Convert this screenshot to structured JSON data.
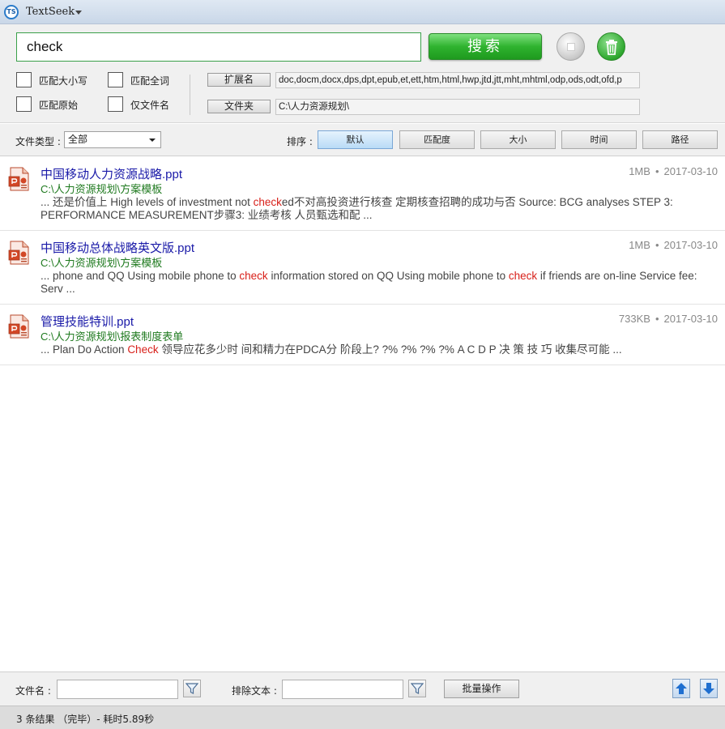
{
  "app": {
    "logo_text": "TS",
    "title": "TextSeek"
  },
  "search": {
    "query": "check",
    "button_label": "搜索",
    "options": [
      {
        "label": "匹配大小写",
        "checked": false
      },
      {
        "label": "匹配全词",
        "checked": false
      },
      {
        "label": "匹配原始",
        "checked": false
      },
      {
        "label": "仅文件名",
        "checked": false
      }
    ],
    "extensions_label": "扩展名",
    "extensions_value": "doc,docm,docx,dps,dpt,epub,et,ett,htm,html,hwp,jtd,jtt,mht,mhtml,odp,ods,odt,ofd,p",
    "folder_label": "文件夹",
    "folder_value": "C:\\人力资源规划\\"
  },
  "filter": {
    "type_label": "文件类型 :",
    "type_value": "全部",
    "sort_label": "排序 :",
    "sort_buttons": [
      "默认",
      "匹配度",
      "大小",
      "时间",
      "路径"
    ],
    "active_sort": "默认"
  },
  "results": [
    {
      "title": "中国移动人力资源战略.ppt",
      "size": "1MB",
      "date": "2017-03-10",
      "path": "C:\\人力资源规划\\方案模板",
      "snippet": [
        {
          "text": "... 还是价值上 High levels of investment not ",
          "hl": false
        },
        {
          "text": "check",
          "hl": true
        },
        {
          "text": "ed不对高投资进行核查 定期核查招聘的成功与否 Source: BCG analyses STEP 3: PERFORMANCE MEASUREMENT步骤3: 业绩考核 人员甄选和配 ...",
          "hl": false
        }
      ]
    },
    {
      "title": "中国移动总体战略英文版.ppt",
      "size": "1MB",
      "date": "2017-03-10",
      "path": "C:\\人力资源规划\\方案模板",
      "snippet": [
        {
          "text": "... phone and QQ Using mobile phone to ",
          "hl": false
        },
        {
          "text": "check",
          "hl": true
        },
        {
          "text": " information stored on QQ Using mobile phone to ",
          "hl": false
        },
        {
          "text": "check",
          "hl": true
        },
        {
          "text": " if friends are on-line Service fee: Serv ...",
          "hl": false
        }
      ]
    },
    {
      "title": "管理技能特训.ppt",
      "size": "733KB",
      "date": "2017-03-10",
      "path": "C:\\人力资源规划\\报表制度表单",
      "snippet": [
        {
          "text": "... Plan Do Action ",
          "hl": false
        },
        {
          "text": "Check",
          "hl": true
        },
        {
          "text": " 领导应花多少时 间和精力在PDCA分 阶段上? ?% ?% ?% ?% A C D P 决 策 技 巧 收集尽可能 ...",
          "hl": false
        }
      ]
    }
  ],
  "bottom": {
    "filename_label": "文件名 :",
    "exclude_label": "排除文本 :",
    "batch_label": "批量操作"
  },
  "status": {
    "text": "3 条结果  （完毕）- 耗时5.89秒"
  },
  "colors": {
    "accent_green": "#2fb32f",
    "highlight_red": "#d8201a",
    "title_blue": "#1a1aa8",
    "path_green": "#1f7a1f"
  }
}
